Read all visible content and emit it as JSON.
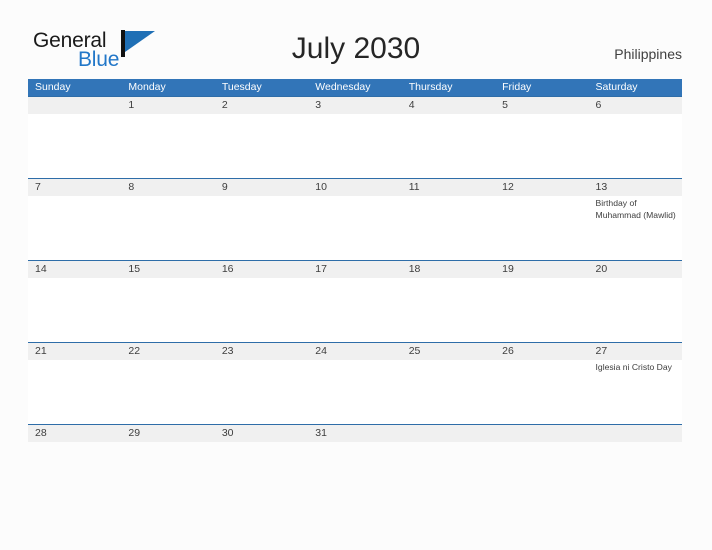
{
  "brand": {
    "word_one": "General",
    "word_two": "Blue",
    "flag_icon": "flag-triangle-icon",
    "accent_color": "#2277c8",
    "dark_color": "#1a1a1a"
  },
  "header": {
    "title": "July 2030",
    "country": "Philippines"
  },
  "colors": {
    "header_blue": "#3275b8",
    "row_divider_blue": "#2e6da8",
    "date_strip_gray": "#f0f0f0",
    "page_background": "#fcfcfc",
    "text": "#3d3d3d"
  },
  "calendar": {
    "weekdays": [
      "Sunday",
      "Monday",
      "Tuesday",
      "Wednesday",
      "Thursday",
      "Friday",
      "Saturday"
    ],
    "weeks": [
      {
        "dates": [
          "",
          "1",
          "2",
          "3",
          "4",
          "5",
          "6"
        ],
        "events": [
          "",
          "",
          "",
          "",
          "",
          "",
          ""
        ]
      },
      {
        "dates": [
          "7",
          "8",
          "9",
          "10",
          "11",
          "12",
          "13"
        ],
        "events": [
          "",
          "",
          "",
          "",
          "",
          "",
          "Birthday of Muhammad (Mawlid)"
        ]
      },
      {
        "dates": [
          "14",
          "15",
          "16",
          "17",
          "18",
          "19",
          "20"
        ],
        "events": [
          "",
          "",
          "",
          "",
          "",
          "",
          ""
        ]
      },
      {
        "dates": [
          "21",
          "22",
          "23",
          "24",
          "25",
          "26",
          "27"
        ],
        "events": [
          "",
          "",
          "",
          "",
          "",
          "",
          "Iglesia ni Cristo Day"
        ]
      },
      {
        "dates": [
          "28",
          "29",
          "30",
          "31",
          "",
          "",
          ""
        ],
        "events": [
          "",
          "",
          "",
          "",
          "",
          "",
          ""
        ]
      }
    ]
  }
}
